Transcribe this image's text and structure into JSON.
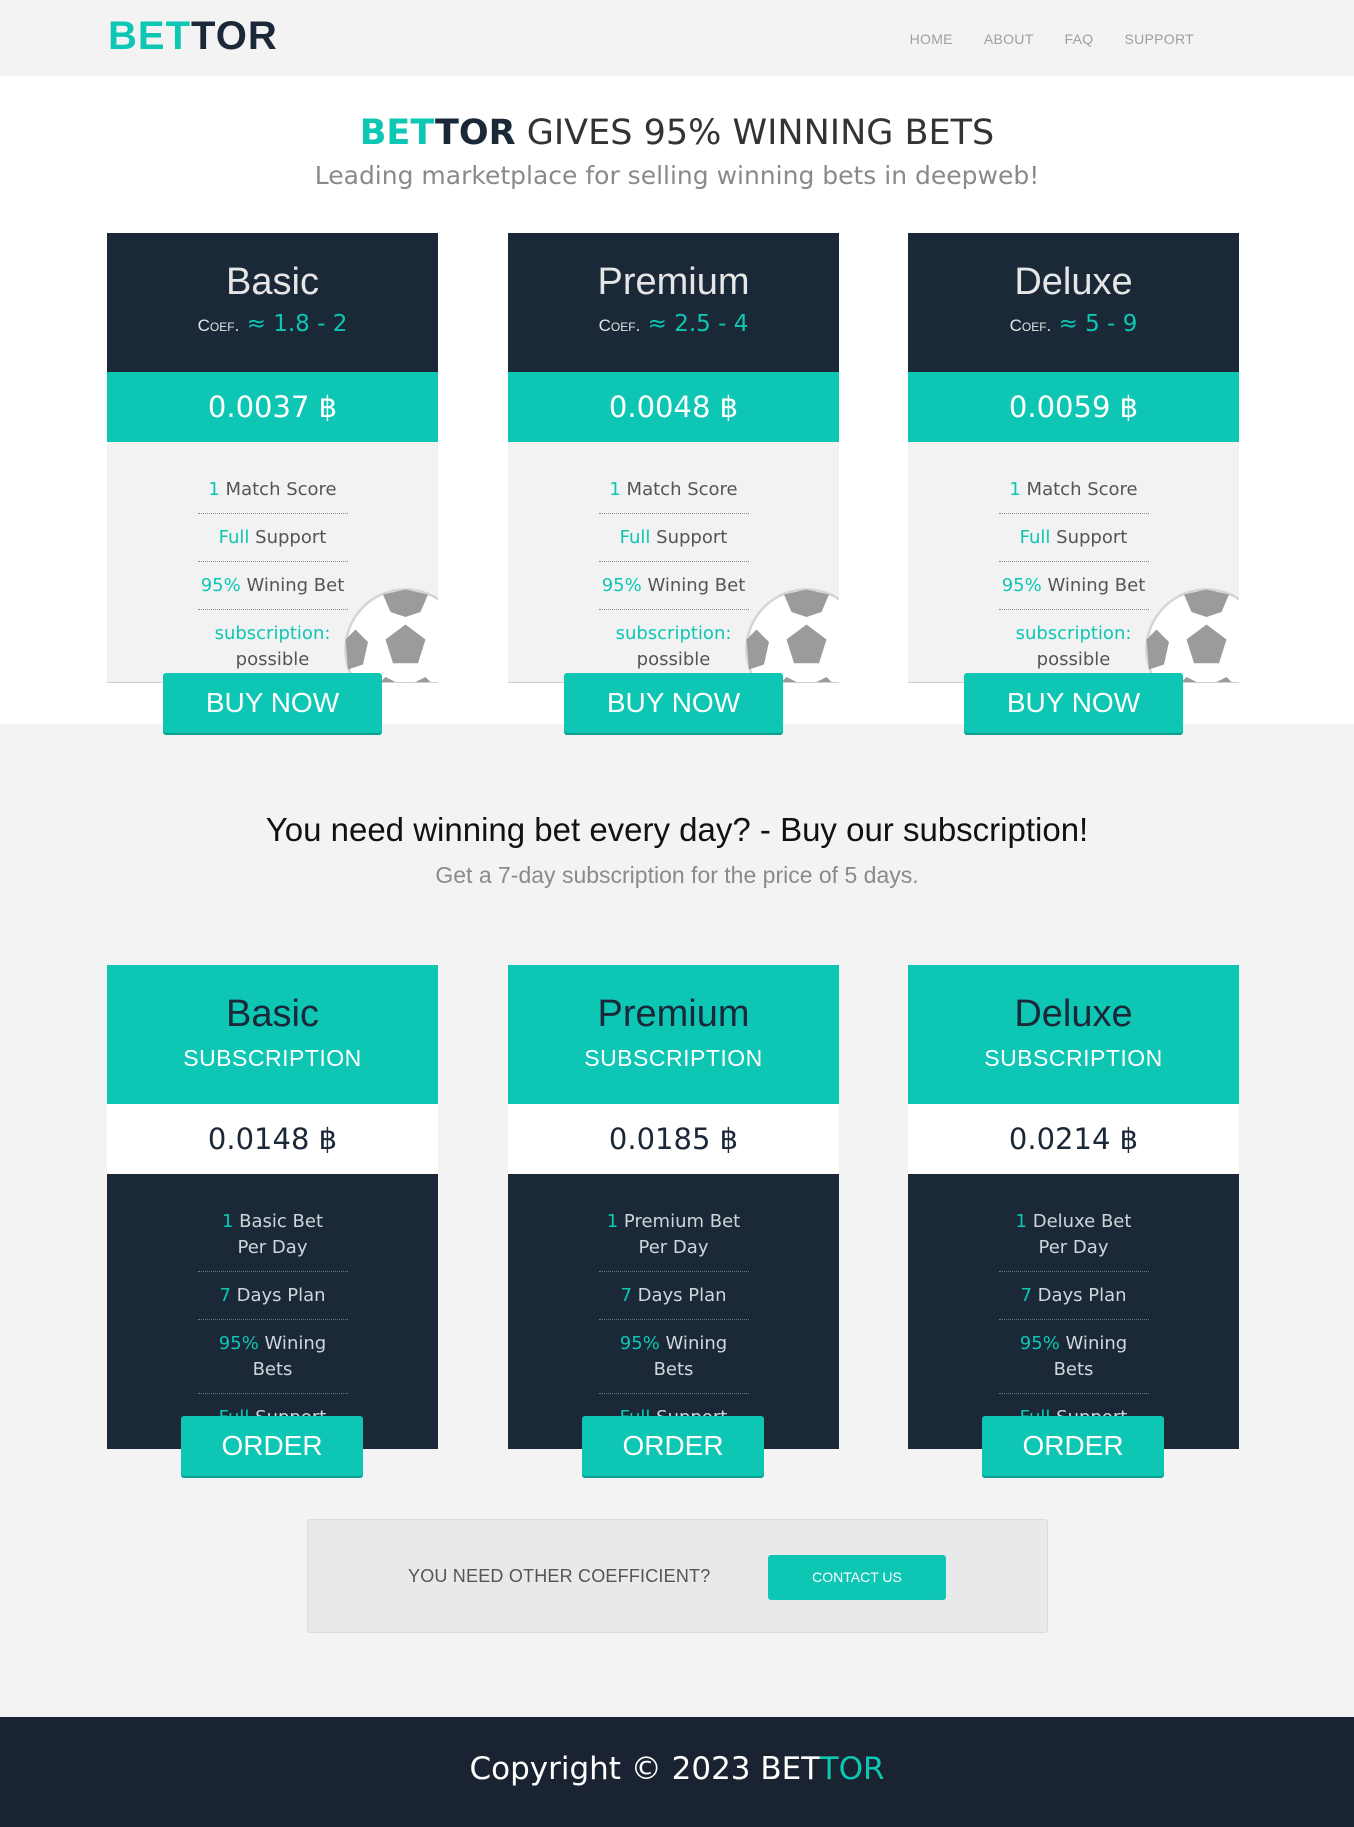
{
  "header": {
    "logo_part1": "BET",
    "logo_part2": "TOR",
    "nav": [
      "HOME",
      "ABOUT",
      "FAQ",
      "SUPPORT"
    ]
  },
  "hero": {
    "brand_part1": "BET",
    "brand_part2": "TOR",
    "title_rest": " GIVES 95% WINNING BETS",
    "subtitle": "Leading marketplace for selling winning bets in deepweb!"
  },
  "bet_plans": [
    {
      "name": "Basic",
      "coef_label": "Coef.",
      "coef": "≈ 1.8 - 2",
      "price": "0.0037 ฿",
      "features": [
        {
          "accent": "1",
          "text": " Match Score"
        },
        {
          "accent": "Full",
          "text": " Support"
        },
        {
          "accent": "95%",
          "text": " Wining Bet"
        },
        {
          "accent": "subscription:",
          "text": "possible"
        }
      ],
      "button": "BUY NOW"
    },
    {
      "name": "Premium",
      "coef_label": "Coef.",
      "coef": "≈ 2.5 - 4",
      "price": "0.0048 ฿",
      "features": [
        {
          "accent": "1",
          "text": " Match Score"
        },
        {
          "accent": "Full",
          "text": " Support"
        },
        {
          "accent": "95%",
          "text": " Wining Bet"
        },
        {
          "accent": "subscription:",
          "text": "possible"
        }
      ],
      "button": "BUY NOW"
    },
    {
      "name": "Deluxe",
      "coef_label": "Coef.",
      "coef": "≈ 5 - 9",
      "price": "0.0059 ฿",
      "features": [
        {
          "accent": "1",
          "text": " Match Score"
        },
        {
          "accent": "Full",
          "text": " Support"
        },
        {
          "accent": "95%",
          "text": " Wining Bet"
        },
        {
          "accent": "subscription:",
          "text": "possible"
        }
      ],
      "button": "BUY NOW"
    }
  ],
  "subscription_section": {
    "title": "You need winning bet every day? - Buy our subscription!",
    "subtitle": "Get a 7-day subscription for the price of 5 days."
  },
  "sub_plans": [
    {
      "name": "Basic",
      "label": "SUBSCRIPTION",
      "price": "0.0148 ฿",
      "features": [
        {
          "accent": "1",
          "text": " Basic Bet",
          "text2": "Per Day"
        },
        {
          "accent": "7",
          "text": " Days Plan"
        },
        {
          "accent": "95%",
          "text": " Wining Bets"
        },
        {
          "accent": "Full",
          "text": " Support"
        }
      ],
      "button": "ORDER"
    },
    {
      "name": "Premium",
      "label": "SUBSCRIPTION",
      "price": "0.0185 ฿",
      "features": [
        {
          "accent": "1",
          "text": " Premium Bet",
          "text2": "Per Day"
        },
        {
          "accent": "7",
          "text": " Days Plan"
        },
        {
          "accent": "95%",
          "text": " Wining Bets"
        },
        {
          "accent": "Full",
          "text": " Support"
        }
      ],
      "button": "ORDER"
    },
    {
      "name": "Deluxe",
      "label": "SUBSCRIPTION",
      "price": "0.0214 ฿",
      "features": [
        {
          "accent": "1",
          "text": " Deluxe Bet",
          "text2": "Per Day"
        },
        {
          "accent": "7",
          "text": " Days Plan"
        },
        {
          "accent": "95%",
          "text": " Wining Bets"
        },
        {
          "accent": "Full",
          "text": " Support"
        }
      ],
      "button": "ORDER"
    }
  ],
  "contact": {
    "text": "YOU NEED OTHER COEFFICIENT?",
    "button": "CONTACT US"
  },
  "footer": {
    "text_part1": "Copyright © 2023 BET",
    "text_part2": "TOR"
  },
  "colors": {
    "accent": "#0dc7b4",
    "navy": "#1a2838",
    "footer": "#1a2331"
  },
  "icons": {
    "ball": "soccer-ball-icon"
  }
}
